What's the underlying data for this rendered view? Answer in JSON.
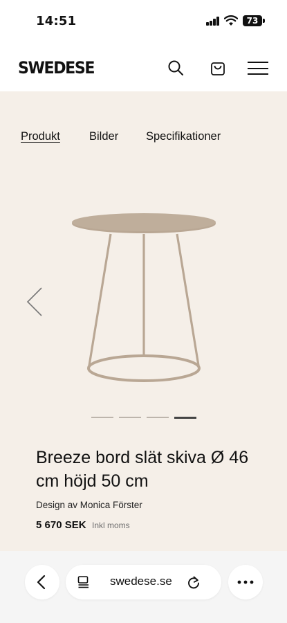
{
  "status_bar": {
    "time": "14:51",
    "battery": "73"
  },
  "header": {
    "logo": "SWEDESE",
    "icons": [
      "search-icon",
      "cart-icon",
      "menu-icon"
    ]
  },
  "tabs": [
    {
      "label": "Produkt",
      "active": true
    },
    {
      "label": "Bilder",
      "active": false
    },
    {
      "label": "Specifikationer",
      "active": false
    }
  ],
  "gallery": {
    "slide_count": 4,
    "active_slide": 4
  },
  "product": {
    "title": "Breeze bord slät skiva Ø 46 cm höjd 50 cm",
    "designer": "Design av Monica Förster",
    "price": "5 670 SEK",
    "vat_note": "Inkl moms"
  },
  "browser": {
    "url": "swedese.se"
  },
  "colors": {
    "product_background": "#f5efe8",
    "table_color": "#b9a794",
    "toolbar_background": "#f5f5f5"
  }
}
